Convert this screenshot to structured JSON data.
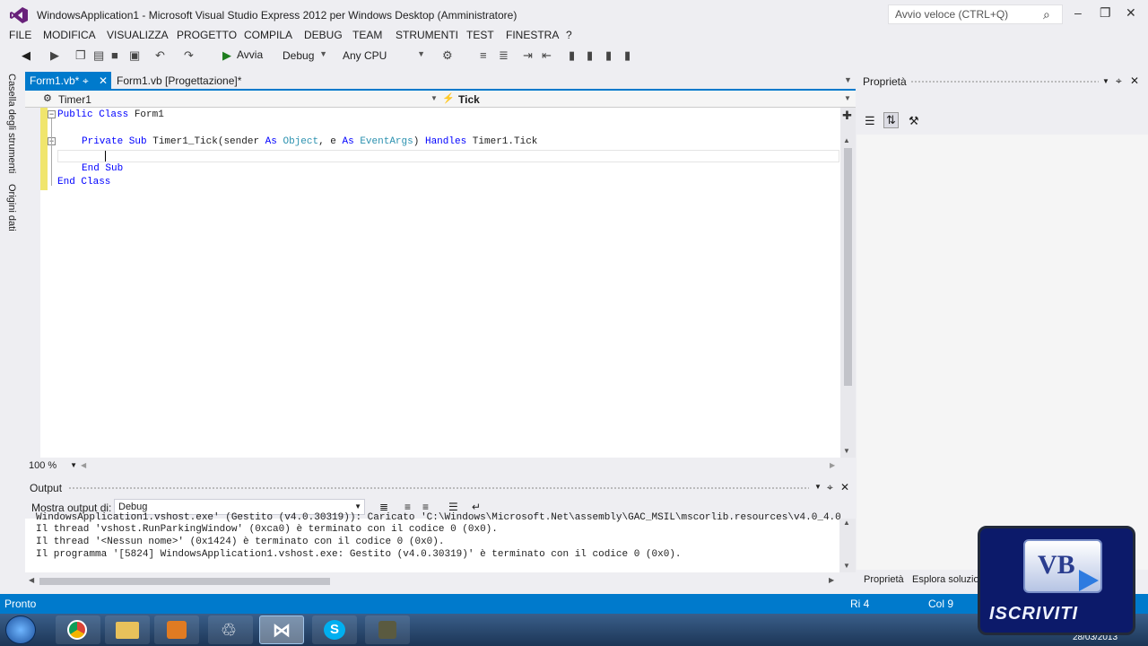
{
  "window": {
    "title": "WindowsApplication1 - Microsoft Visual Studio Express 2012 per Windows Desktop (Amministratore)",
    "quick_launch_placeholder": "Avvio veloce (CTRL+Q)"
  },
  "menu": [
    "FILE",
    "MODIFICA",
    "VISUALIZZA",
    "PROGETTO",
    "COMPILA",
    "DEBUG",
    "TEAM",
    "STRUMENTI",
    "TEST",
    "FINESTRA",
    "?"
  ],
  "toolbar": {
    "start_label": "Avvia",
    "config": "Debug",
    "platform": "Any CPU"
  },
  "left_strip": {
    "toolbox": "Casella degli strumenti",
    "data_sources": "Origini dati"
  },
  "tabs": {
    "code_tab": "Form1.vb*",
    "design_tab": "Form1.vb [Progettazione]*"
  },
  "navbar": {
    "object": "Timer1",
    "event": "Tick"
  },
  "code": {
    "l1_kw": "Public Class",
    "l1_name": "Form1",
    "l2_kw1": "Private Sub",
    "l2_name": "Timer1_Tick(sender",
    "l2_as1": "As",
    "l2_ty1": "Object",
    "l2_mid": ", e",
    "l2_as2": "As",
    "l2_ty2": "EventArgs",
    "l2_close": ")",
    "l2_handles": "Handles",
    "l2_target": "Timer1.Tick",
    "l4": "End Sub",
    "l5": "End Class"
  },
  "zoom": "100 %",
  "properties": {
    "title": "Proprietà",
    "tab_props": "Proprietà",
    "tab_solution": "Esplora soluzio"
  },
  "output": {
    "title": "Output",
    "show_from_label": "Mostra output di:",
    "source": "Debug",
    "lines": [
      "WindowsApplication1.vshost.exe' (Gestito (v4.0.30319)): Caricato 'C:\\Windows\\Microsoft.Net\\assembly\\GAC_MSIL\\mscorlib.resources\\v4.0_4.0",
      "Il thread 'vshost.RunParkingWindow' (0xca0) è terminato con il codice 0 (0x0).",
      "Il thread '<Nessun nome>' (0x1424) è terminato con il codice 0 (0x0).",
      "Il programma '[5824] WindowsApplication1.vshost.exe: Gestito (v4.0.30319)' è terminato con il codice 0 (0x0)."
    ]
  },
  "status": {
    "state": "Pronto",
    "row": "Ri 4",
    "col": "Col 9"
  },
  "taskbar": {
    "date": "28/03/2013"
  },
  "overlay": {
    "logo": "VB",
    "subscribe": "ISCRIVITI"
  },
  "colors": {
    "accent": "#007acc",
    "keyword": "#0000ff",
    "type": "#2b91af"
  }
}
